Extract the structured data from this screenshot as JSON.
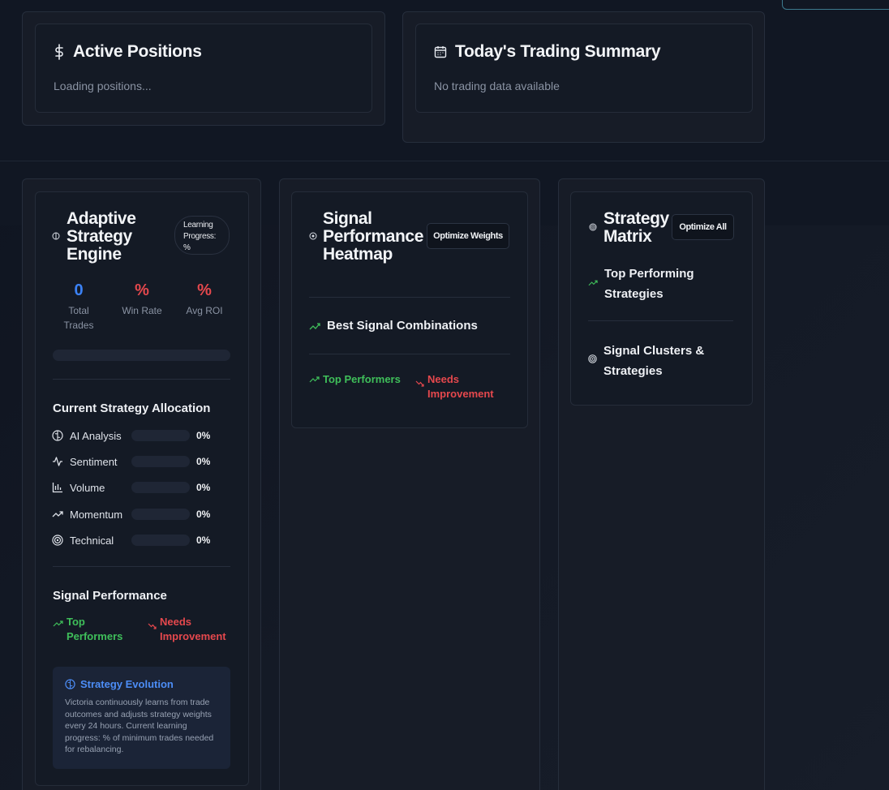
{
  "active_positions": {
    "title": "Active Positions",
    "status": "Loading positions..."
  },
  "trading_summary": {
    "title": "Today's Trading Summary",
    "status": "No trading data available"
  },
  "adaptive_engine": {
    "title_line1": "Adaptive",
    "title_line2": "Strategy",
    "title_line3": "Engine",
    "badge_line1": "Learning",
    "badge_line2": "Progress:",
    "badge_line3": "%",
    "stats": [
      {
        "value": "0",
        "label_line1": "Total",
        "label_line2": "Trades",
        "color": "#3b82f6"
      },
      {
        "value": "%",
        "label_line1": "Win Rate",
        "label_line2": "",
        "color": "#e5484d"
      },
      {
        "value": "%",
        "label_line1": "Avg ROI",
        "label_line2": "",
        "color": "#e5484d"
      }
    ],
    "allocation_title": "Current Strategy Allocation",
    "allocation": [
      {
        "icon": "brain-icon",
        "label": "AI Analysis",
        "value": "0%"
      },
      {
        "icon": "activity-icon",
        "label": "Sentiment",
        "value": "0%"
      },
      {
        "icon": "bar-chart-icon",
        "label": "Volume",
        "value": "0%"
      },
      {
        "icon": "trending-up-icon",
        "label": "Momentum",
        "value": "0%"
      },
      {
        "icon": "target-icon",
        "label": "Technical",
        "value": "0%"
      }
    ],
    "signal_perf_title": "Signal Performance",
    "top_line1": "Top",
    "top_line2": "Performers",
    "needs_line1": "Needs",
    "needs_line2": "Improvement",
    "evolution_title": "Strategy Evolution",
    "evolution_text": "Victoria continuously learns from trade outcomes and adjusts strategy weights every 24 hours. Current learning progress: % of minimum trades needed for rebalancing."
  },
  "heatmap": {
    "title_line1": "Signal",
    "title_line2": "Performance",
    "title_line3": "Heatmap",
    "button": "Optimize Weights",
    "best_combos": "Best Signal Combinations",
    "top_performers": "Top Performers",
    "needs_line1": "Needs",
    "needs_line2": "Improvement"
  },
  "matrix": {
    "title_line1": "Strategy",
    "title_line2": "Matrix",
    "button": "Optimize All",
    "top_line1": "Top Performing",
    "top_line2": "Strategies",
    "clusters_line1": "Signal Clusters &",
    "clusters_line2": "Strategies"
  },
  "colors": {
    "accent_blue": "#3b82f6",
    "positive": "#3fbf5a",
    "negative": "#e5484d",
    "background": "#111723"
  }
}
